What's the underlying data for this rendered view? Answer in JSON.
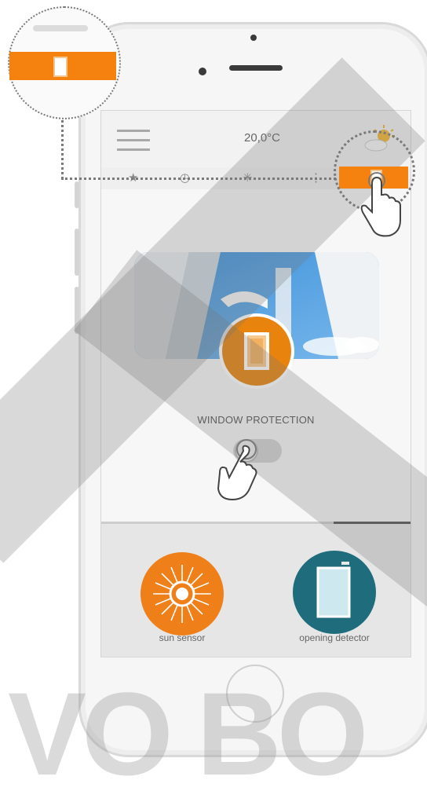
{
  "status_bar": {
    "temperature": "20,0°C"
  },
  "icons": {
    "menu": "hamburger-menu-icon",
    "weather": "sun-cloud-icon",
    "tabs": [
      "star-icon",
      "clock-icon",
      "sun-icon",
      "window-icon"
    ]
  },
  "window_protection": {
    "label": "WINDOW PROTECTION",
    "toggle_on": false
  },
  "devices": [
    {
      "label": "sun sensor",
      "icon": "sun-sensor-icon",
      "color": "#ef7f18"
    },
    {
      "label": "opening detector",
      "icon": "opening-detector-icon",
      "color": "#1f6c7c"
    }
  ],
  "colors": {
    "accent": "#f5820f",
    "teal": "#1f6c7c",
    "screen_bg": "#f7f7f7"
  },
  "watermark": {
    "text": "VO BO"
  }
}
